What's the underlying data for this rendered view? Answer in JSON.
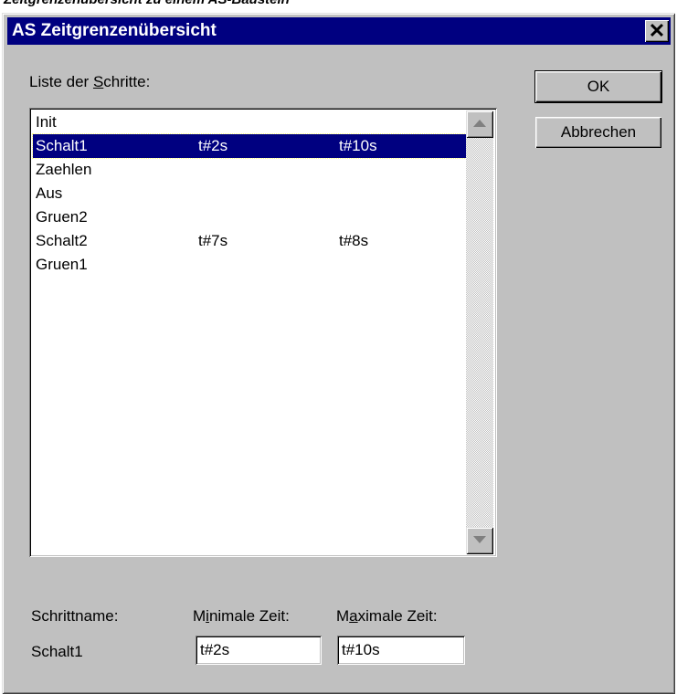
{
  "caption": "Zeitgrenzenübersicht zu einem AS-Baustein",
  "dialog": {
    "title": "AS Zeitgrenzenübersicht",
    "close_glyph": "✕",
    "list_label_pre": "Liste der ",
    "list_label_mnemonic": "S",
    "list_label_post": "chritte:",
    "ok_label": "OK",
    "cancel_label": "Abbrechen"
  },
  "steps": [
    {
      "name": "Init",
      "min": "",
      "max": ""
    },
    {
      "name": "Schalt1",
      "min": "t#2s",
      "max": "t#10s"
    },
    {
      "name": "Zaehlen",
      "min": "",
      "max": ""
    },
    {
      "name": "Aus",
      "min": "",
      "max": ""
    },
    {
      "name": "Gruen2",
      "min": "",
      "max": ""
    },
    {
      "name": "Schalt2",
      "min": "t#7s",
      "max": "t#8s"
    },
    {
      "name": "Gruen1",
      "min": "",
      "max": ""
    }
  ],
  "selected_index": 1,
  "bottom": {
    "step_name_label": "Schrittname:",
    "min_label_pre": "M",
    "min_label_mnemonic": "i",
    "min_label_post": "nimale Zeit:",
    "max_label_pre": "M",
    "max_label_mnemonic": "a",
    "max_label_post": "ximale Zeit:",
    "step_name_value": "Schalt1",
    "min_value": "t#2s",
    "max_value": "t#10s"
  },
  "icons": {
    "scroll_up": "scroll-up-arrow-icon",
    "scroll_down": "scroll-down-arrow-icon",
    "close": "close-icon"
  }
}
